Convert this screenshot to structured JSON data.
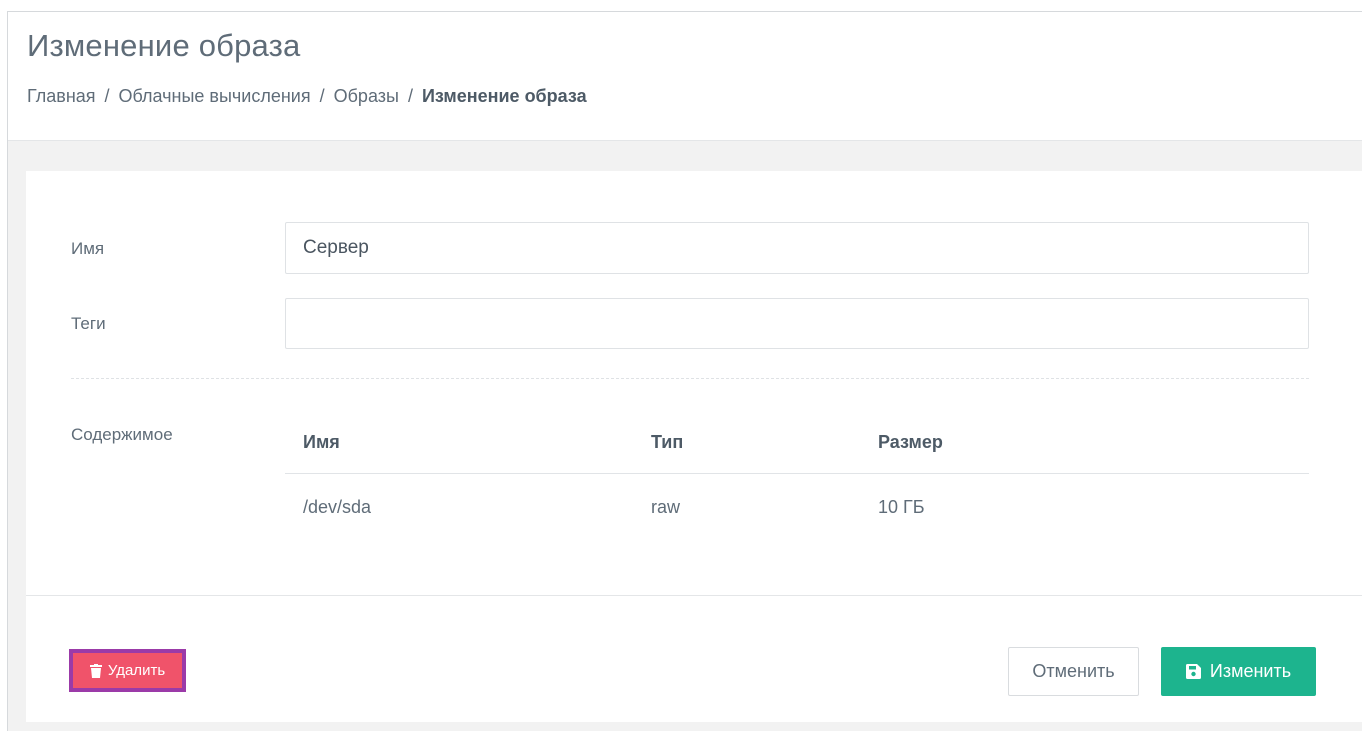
{
  "header": {
    "title": "Изменение образа",
    "breadcrumb": {
      "items": [
        "Главная",
        "Облачные вычисления",
        "Образы"
      ],
      "current": "Изменение образа",
      "separator": "/"
    }
  },
  "form": {
    "name_label": "Имя",
    "name_value": "Сервер",
    "tags_label": "Теги",
    "tags_value": "",
    "content_label": "Содержимое"
  },
  "content_table": {
    "columns": [
      "Имя",
      "Тип",
      "Размер"
    ],
    "rows": [
      [
        "/dev/sda",
        "raw",
        "10 ГБ"
      ]
    ]
  },
  "actions": {
    "delete_label": "Удалить",
    "cancel_label": "Отменить",
    "save_label": "Изменить"
  },
  "colors": {
    "delete": "#f0536a",
    "delete_highlight": "#9b3aa8",
    "save": "#1db48e"
  },
  "icons": {
    "delete": "trash-icon",
    "save": "floppy-disk-icon"
  }
}
